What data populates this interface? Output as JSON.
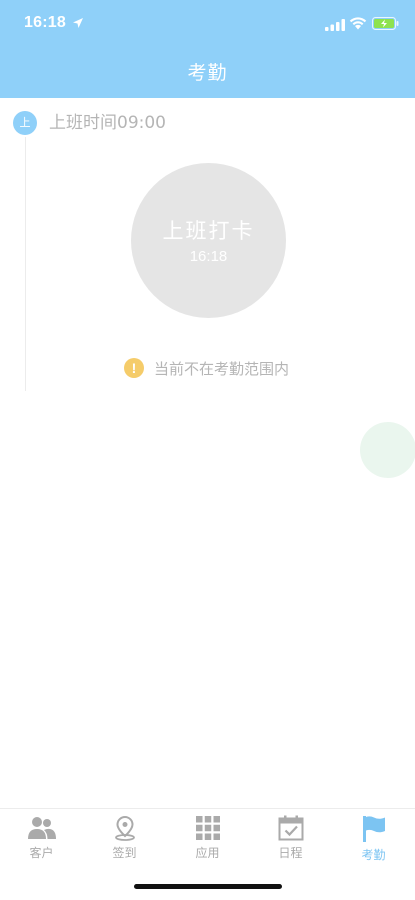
{
  "status_bar": {
    "time": "16:18"
  },
  "header": {
    "title": "考勤"
  },
  "schedule": {
    "badge": "上",
    "shift_time": "上班时间09:00"
  },
  "punch": {
    "label": "上班打卡",
    "time": "16:18"
  },
  "warning": {
    "text": "当前不在考勤范围内"
  },
  "tabs": [
    {
      "label": "客户",
      "icon": "customers-icon",
      "active": false
    },
    {
      "label": "签到",
      "icon": "location-pin-icon",
      "active": false
    },
    {
      "label": "应用",
      "icon": "grid-icon",
      "active": false
    },
    {
      "label": "日程",
      "icon": "calendar-check-icon",
      "active": false
    },
    {
      "label": "考勤",
      "icon": "flag-icon",
      "active": true
    }
  ],
  "colors": {
    "header_bg": "#8fd0f9",
    "accent": "#7cc4f2",
    "inactive": "#aaaaaa",
    "warning": "#f5cc6a",
    "punch_bg": "#e5e5e5"
  }
}
